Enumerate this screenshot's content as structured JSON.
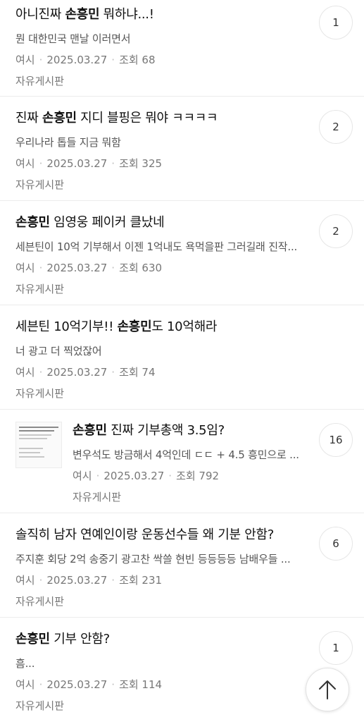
{
  "posts": [
    {
      "title_pre": "아니진짜 ",
      "title_bold": "손흥민",
      "title_post": " 뭐하냐...!",
      "excerpt": "뭔 대한민국 맨날 이러면서",
      "author": "여시",
      "date": "2025.03.27",
      "views": "조회 68",
      "board": "자유게시판",
      "comments": "1"
    },
    {
      "title_pre": "진짜 ",
      "title_bold": "손흥민",
      "title_post": " 지디 블핑은 뭐야 ㅋㅋㅋㅋ",
      "excerpt": "우리나라 톱들 지금 뭐함",
      "author": "여시",
      "date": "2025.03.27",
      "views": "조회 325",
      "board": "자유게시판",
      "comments": "2"
    },
    {
      "title_pre": "",
      "title_bold": "손흥민",
      "title_post": " 임영웅 페이커 클났네",
      "excerpt": "세븐틴이 10억 기부해서 이젠 1억내도 욕먹을판 그러길래 진작...",
      "author": "여시",
      "date": "2025.03.27",
      "views": "조회 630",
      "board": "자유게시판",
      "comments": "2"
    },
    {
      "title_pre": "세븐틴 10억기부!! ",
      "title_bold": "손흥민",
      "title_post": "도 10억해라",
      "excerpt": "너 광고 더 찍었잖어",
      "author": "여시",
      "date": "2025.03.27",
      "views": "조회 74",
      "board": "자유게시판",
      "comments": ""
    },
    {
      "title_pre": "",
      "title_bold": "손흥민",
      "title_post": " 진짜 기부총액 3.5임?",
      "excerpt": "변우석도 방금해서 4억인데 ㄷㄷ + 4.5 흥민으로 ...",
      "author": "여시",
      "date": "2025.03.27",
      "views": "조회 792",
      "board": "자유게시판",
      "comments": "16"
    },
    {
      "title_pre": "솔직히 남자 연예인이랑 운동선수들 왜 기분 안함?",
      "title_bold": "",
      "title_post": "",
      "excerpt": "주지훈 회당 2억 송중기 광고찬 싹쓸 현빈 등등등등 남배우들 ...",
      "author": "여시",
      "date": "2025.03.27",
      "views": "조회 231",
      "board": "자유게시판",
      "comments": "6"
    },
    {
      "title_pre": "",
      "title_bold": "손흥민",
      "title_post": " 기부 안함?",
      "excerpt": "흠...",
      "author": "여시",
      "date": "2025.03.27",
      "views": "조회 114",
      "board": "자유게시판",
      "comments": "1"
    }
  ],
  "icons": {
    "thumbnail": "image-thumbnail",
    "scroll_top": "arrow-up-icon"
  }
}
